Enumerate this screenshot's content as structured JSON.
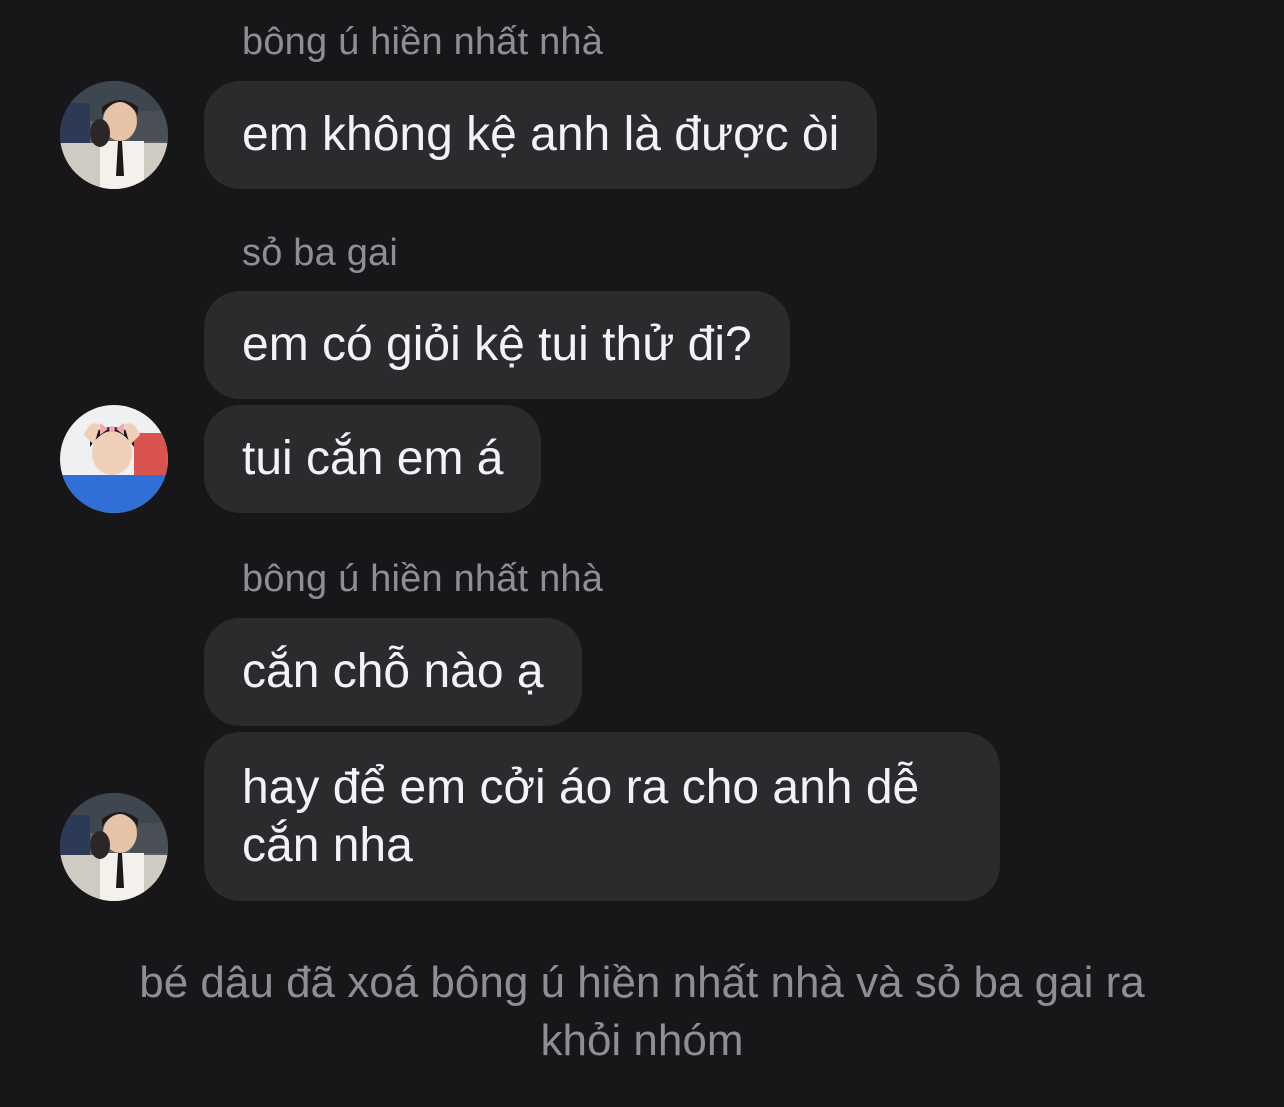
{
  "messages": [
    {
      "sender": "bông ú hiền nhất nhà",
      "text": "em không kệ anh là được òi",
      "avatar": "avatar-photo-bong-u"
    },
    {
      "sender": "sỏ ba gai",
      "text": "em có giỏi kệ tui thử đi?",
      "avatar": null
    },
    {
      "sender": null,
      "text": "tui cắn em á",
      "avatar": "avatar-photo-so-ba-gai"
    },
    {
      "sender": "bông ú hiền nhất nhà",
      "text": "cắn chỗ nào ạ",
      "avatar": null
    },
    {
      "sender": null,
      "text": "hay để em cởi áo ra cho anh dễ cắn nha",
      "avatar": "avatar-photo-bong-u"
    }
  ],
  "system_message": "bé dâu đã xoá bông ú hiền nhất nhà và sỏ ba gai ra khỏi nhóm",
  "colors": {
    "background": "#17171a",
    "bubble": "#2b2b2e",
    "message_text": "#f2f2f7",
    "secondary_text": "#8e8e93"
  }
}
